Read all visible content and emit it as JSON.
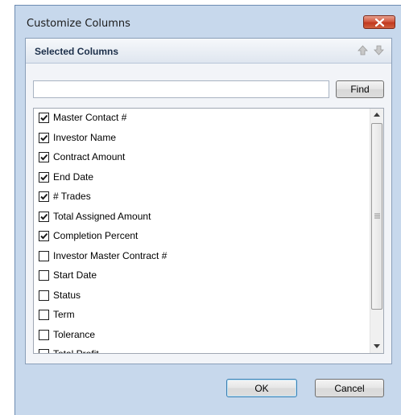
{
  "dialog": {
    "title": "Customize Columns"
  },
  "panel": {
    "title": "Selected Columns"
  },
  "search": {
    "value": "",
    "placeholder": ""
  },
  "buttons": {
    "find": "Find",
    "ok": "OK",
    "cancel": "Cancel"
  },
  "columns": [
    {
      "label": "Master Contact #",
      "checked": true
    },
    {
      "label": "Investor Name",
      "checked": true
    },
    {
      "label": "Contract Amount",
      "checked": true
    },
    {
      "label": "End Date",
      "checked": true
    },
    {
      "label": "# Trades",
      "checked": true
    },
    {
      "label": "Total Assigned Amount",
      "checked": true
    },
    {
      "label": "Completion Percent",
      "checked": true
    },
    {
      "label": "Investor Master Contract #",
      "checked": false
    },
    {
      "label": "Start Date",
      "checked": false
    },
    {
      "label": "Status",
      "checked": false
    },
    {
      "label": "Term",
      "checked": false
    },
    {
      "label": "Tolerance",
      "checked": false
    },
    {
      "label": "Total Profit",
      "checked": false
    }
  ],
  "colors": {
    "titlebar": "#c7d8ec",
    "close": "#c1391f",
    "check": "#1a1a1a"
  }
}
